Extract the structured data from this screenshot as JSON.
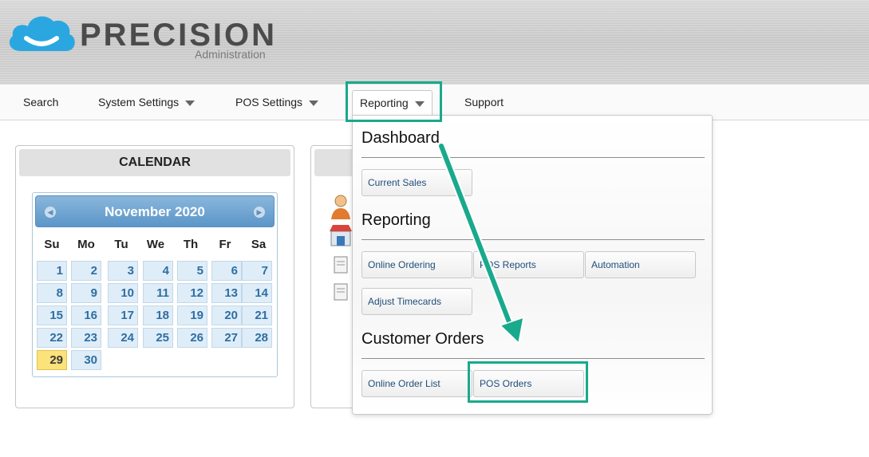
{
  "brand": {
    "name": "PRECISION",
    "subtitle": "Administration",
    "logo_icon": "cloud-smile-icon"
  },
  "nav": {
    "items": [
      {
        "label": "Search",
        "has_dropdown": false
      },
      {
        "label": "System Settings",
        "has_dropdown": true
      },
      {
        "label": "POS Settings",
        "has_dropdown": true
      },
      {
        "label": "Reporting",
        "has_dropdown": true,
        "active": true
      },
      {
        "label": "Support",
        "has_dropdown": false
      }
    ]
  },
  "calendar_panel": {
    "title": "CALENDAR",
    "month": "November 2020",
    "days_of_week": [
      "Su",
      "Mo",
      "Tu",
      "We",
      "Th",
      "Fr",
      "Sa"
    ],
    "days": [
      "1",
      "2",
      "3",
      "4",
      "5",
      "6",
      "7",
      "8",
      "9",
      "10",
      "11",
      "12",
      "13",
      "14",
      "15",
      "16",
      "17",
      "18",
      "19",
      "20",
      "21",
      "22",
      "23",
      "24",
      "25",
      "26",
      "27",
      "28",
      "29",
      "30"
    ],
    "today": "29"
  },
  "dropdown": {
    "sections": [
      {
        "heading": "Dashboard",
        "buttons": [
          "Current Sales"
        ]
      },
      {
        "heading": "Reporting",
        "buttons": [
          "Online Ordering",
          "POS Reports",
          "Automation",
          "Adjust Timecards"
        ]
      },
      {
        "heading": "Customer Orders",
        "buttons": [
          "Online Order List",
          "POS Orders"
        ]
      }
    ]
  },
  "colors": {
    "highlight": "#19a98c",
    "calendar_header": "#5b95c8",
    "today": "#fbe27a",
    "day_text": "#2f6ea2"
  }
}
